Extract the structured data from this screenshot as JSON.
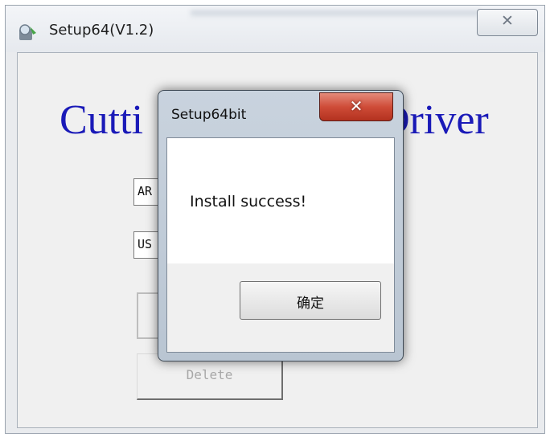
{
  "main_window": {
    "title": "Setup64(V1.2)",
    "close_glyph": "✕",
    "heading_left": "Cutti",
    "heading_right": "Driver",
    "combo1_value": "AR",
    "combo2_value": "US",
    "delete_label": "Delete"
  },
  "dialog": {
    "title": "Setup64bit",
    "close_glyph": "✕",
    "message": "Install success!",
    "ok_label": "确定"
  },
  "colors": {
    "heading": "#1a1ab8",
    "dialog_close": "#cf4c38"
  },
  "icons": {
    "app": "setup-app-icon"
  }
}
